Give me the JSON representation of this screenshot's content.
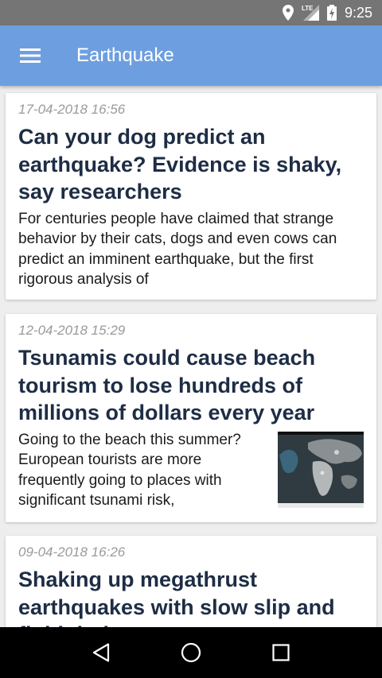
{
  "status_bar": {
    "time": "9:25",
    "network": "LTE",
    "icons": [
      "location-icon",
      "lte-signal-icon",
      "battery-charging-icon"
    ]
  },
  "app_bar": {
    "title": "Earthquake",
    "menu_icon": "hamburger-menu-icon",
    "color": "#6d9fe0"
  },
  "articles": [
    {
      "date": "17-04-2018 16:56",
      "title": "Can your dog predict an earthquake? Evidence is shaky, say researchers",
      "summary": "For centuries people have claimed that strange behavior by their cats, dogs and even cows can predict an imminent earthquake, but the first rigorous analysis of",
      "has_image": false
    },
    {
      "date": "12-04-2018 15:29",
      "title": "Tsunamis could cause beach tourism to lose hundreds of millions of dollars every year",
      "summary": "Going to the beach this summer? European tourists are more frequently going to places with significant tsunami risk,",
      "has_image": true,
      "image_desc": "world-map-thumbnail"
    },
    {
      "date": "09-04-2018 16:26",
      "title": "Shaking up megathrust earthquakes with slow slip and fluid drainage",
      "summary": "",
      "has_image": false
    }
  ],
  "nav_bar": {
    "buttons": [
      "back-icon",
      "home-icon",
      "recents-icon"
    ]
  }
}
